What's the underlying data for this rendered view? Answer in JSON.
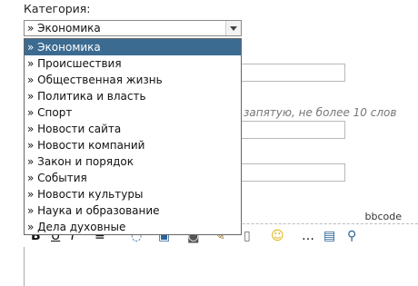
{
  "category_label": "Категория:",
  "select": {
    "value": "» Экономика"
  },
  "options": [
    "» Экономика",
    "» Происшествия",
    "» Общественная жизнь",
    "» Политика и власть",
    "» Спорт",
    "» Новости сайта",
    "» Новости компаний",
    "» Закон и порядок",
    "» События",
    "» Новости культуры",
    "» Наука и образование",
    "» Дела духовные"
  ],
  "selected_index": 0,
  "hint_text": "запятую, не более 10 слов",
  "editor": {
    "mode_label": "bbcode"
  }
}
